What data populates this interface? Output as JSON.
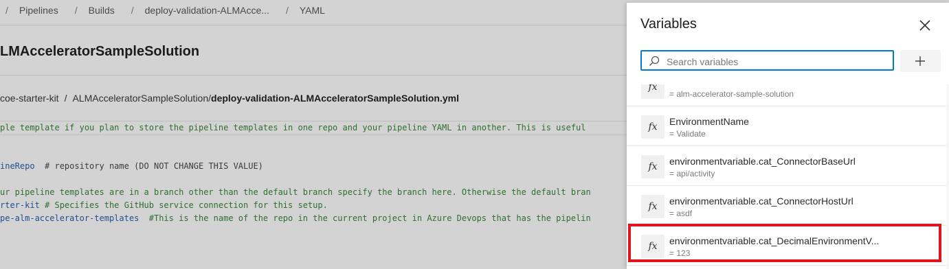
{
  "breadcrumb": {
    "items": [
      "Pipelines",
      "Builds",
      "deploy-validation-ALMAcce...",
      "YAML"
    ]
  },
  "page": {
    "title": "LMAcceleratorSampleSolution",
    "path_prefix": "coe-starter-kit",
    "path_sep": "/",
    "path_dir": "ALMAcceleratorSampleSolution/",
    "path_file": "deploy-validation-ALMAcceleratorSampleSolution.yml"
  },
  "code": {
    "line1": "ple template if you plan to store the pipeline templates in one repo and your pipeline YAML in another. This is useful",
    "line2_a": "ineRepo",
    "line2_b": "  # repository name (DO NOT CHANGE THIS VALUE)",
    "line3": "ur pipeline templates are in a branch other than the default branch specify the branch here. Otherwise the default bran",
    "line4_a": "rter-kit",
    "line4_b": " # Specifies the GitHub service connection for this setup.",
    "line5_a": "pe-alm-accelerator-templates",
    "line5_b": "  #This is the name of the repo in the current project in Azure Devops that has the pipelin"
  },
  "panel": {
    "title": "Variables",
    "search_placeholder": "Search variables",
    "variables": [
      {
        "name": "",
        "value": "= alm-accelerator-sample-solution",
        "icon": "fx"
      },
      {
        "name": "EnvironmentName",
        "value": "= Validate",
        "icon": "fx"
      },
      {
        "name": "environmentvariable.cat_ConnectorBaseUrl",
        "value": "= api/activity",
        "icon": "fx"
      },
      {
        "name": "environmentvariable.cat_ConnectorHostUrl",
        "value": "= asdf",
        "icon": "fx"
      },
      {
        "name": "environmentvariable.cat_DecimalEnvironmentV...",
        "value": "= 123",
        "icon": "fx"
      }
    ]
  },
  "colors": {
    "accent": "#0078d4",
    "highlight": "#e0141e"
  }
}
